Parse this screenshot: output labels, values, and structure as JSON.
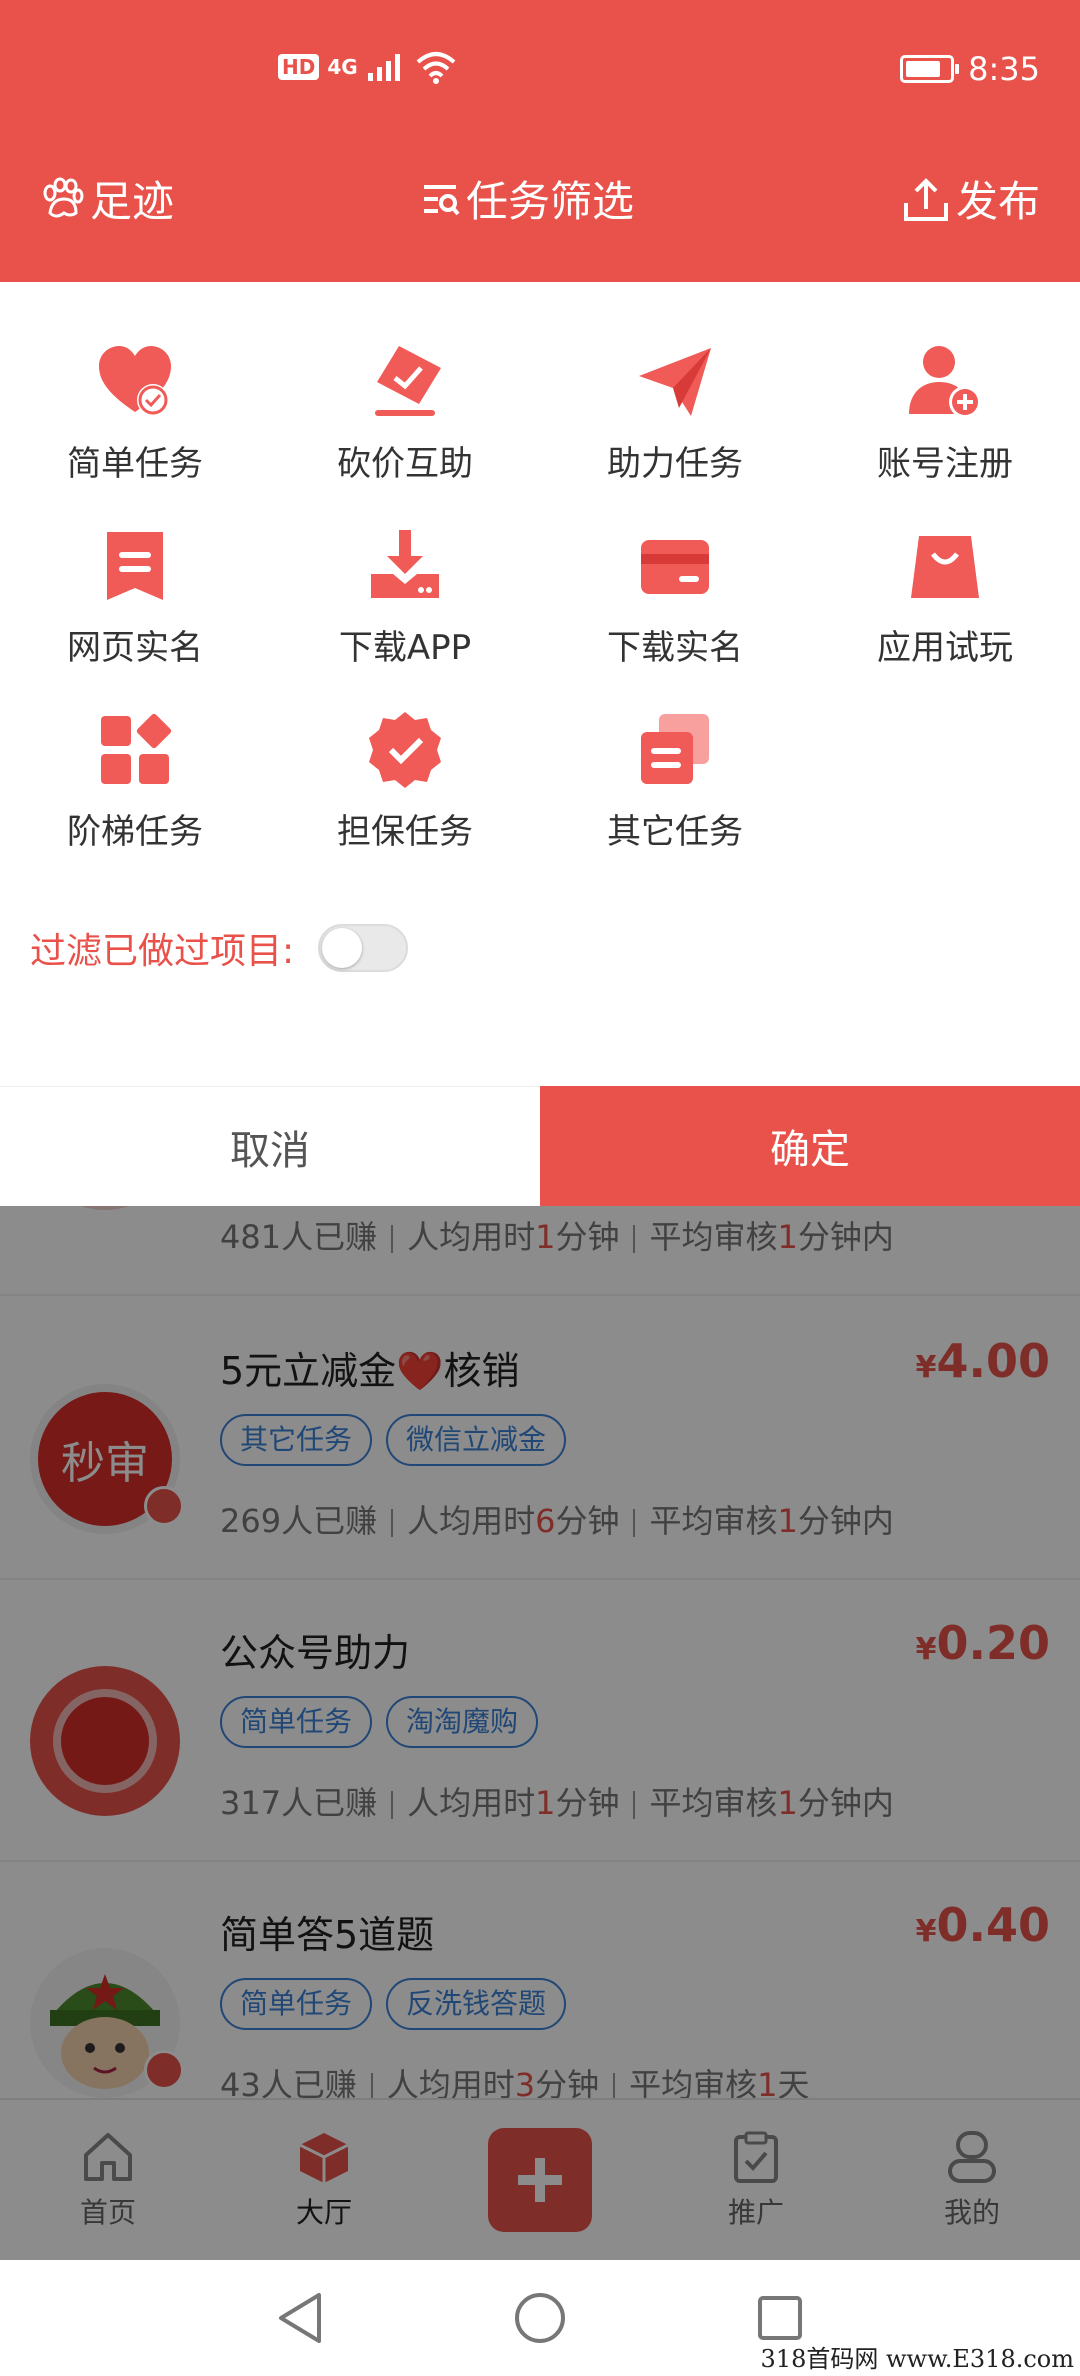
{
  "status_bar": {
    "left_badges": [
      "HD",
      "4G"
    ],
    "signal_icon": "signal-bars-icon",
    "wifi_icon": "wifi-icon",
    "battery_icon": "battery-icon",
    "time": "8:35"
  },
  "header": {
    "left_label": "足迹",
    "left_icon": "paw-icon",
    "title": "任务筛选",
    "title_icon": "filter-list-icon",
    "right_label": "发布",
    "right_icon": "upload-icon"
  },
  "categories": [
    {
      "label": "简单任务",
      "icon": "heart-check-icon"
    },
    {
      "label": "砍价互助",
      "icon": "tag-check-icon"
    },
    {
      "label": "助力任务",
      "icon": "paper-plane-icon"
    },
    {
      "label": "账号注册",
      "icon": "user-add-icon"
    },
    {
      "label": "网页实名",
      "icon": "document-icon"
    },
    {
      "label": "下载APP",
      "icon": "download-icon"
    },
    {
      "label": "下载实名",
      "icon": "card-icon"
    },
    {
      "label": "应用试玩",
      "icon": "shopping-bag-icon"
    },
    {
      "label": "阶梯任务",
      "icon": "grid-blocks-icon"
    },
    {
      "label": "担保任务",
      "icon": "badge-check-icon"
    },
    {
      "label": "其它任务",
      "icon": "stacked-cards-icon"
    }
  ],
  "filter": {
    "label": "过滤已做过项目:",
    "enabled": false
  },
  "actions": {
    "cancel": "取消",
    "confirm": "确定"
  },
  "accent_color": "#e8524a",
  "tasks": [
    {
      "title": "",
      "price": "",
      "tags": [],
      "earned": "481人已赚",
      "avg_time_prefix": "人均用时",
      "avg_time_value": "1",
      "avg_time_unit": "分钟",
      "review_prefix": "平均审核",
      "review_value": "1",
      "review_unit": "分钟内"
    },
    {
      "title": "5元立减金❤️核销",
      "price_symbol": "¥",
      "price": "4.00",
      "avatar_text": "秒审",
      "tags": [
        "其它任务",
        "微信立减金"
      ],
      "earned": "269人已赚",
      "avg_time_prefix": "人均用时",
      "avg_time_value": "6",
      "avg_time_unit": "分钟",
      "review_prefix": "平均审核",
      "review_value": "1",
      "review_unit": "分钟内"
    },
    {
      "title": "公众号助力",
      "price_symbol": "¥",
      "price": "0.20",
      "tags": [
        "简单任务",
        "淘淘魔购"
      ],
      "earned": "317人已赚",
      "avg_time_prefix": "人均用时",
      "avg_time_value": "1",
      "avg_time_unit": "分钟",
      "review_prefix": "平均审核",
      "review_value": "1",
      "review_unit": "分钟内"
    },
    {
      "title": "简单答5道题",
      "price_symbol": "¥",
      "price": "0.40",
      "tags": [
        "简单任务",
        "反洗钱答题"
      ],
      "earned": "43人已赚",
      "avg_time_prefix": "人均用时",
      "avg_time_value": "3",
      "avg_time_unit": "分钟",
      "review_prefix": "平均审核",
      "review_value": "1",
      "review_unit": "天"
    }
  ],
  "tabbar": [
    {
      "label": "首页",
      "icon": "home-icon"
    },
    {
      "label": "大厅",
      "icon": "cube-icon"
    },
    {
      "label": "",
      "icon": "plus-icon"
    },
    {
      "label": "推广",
      "icon": "clipboard-check-icon"
    },
    {
      "label": "我的",
      "icon": "profile-icon"
    }
  ],
  "watermark": "318首码网 www.E318.com"
}
